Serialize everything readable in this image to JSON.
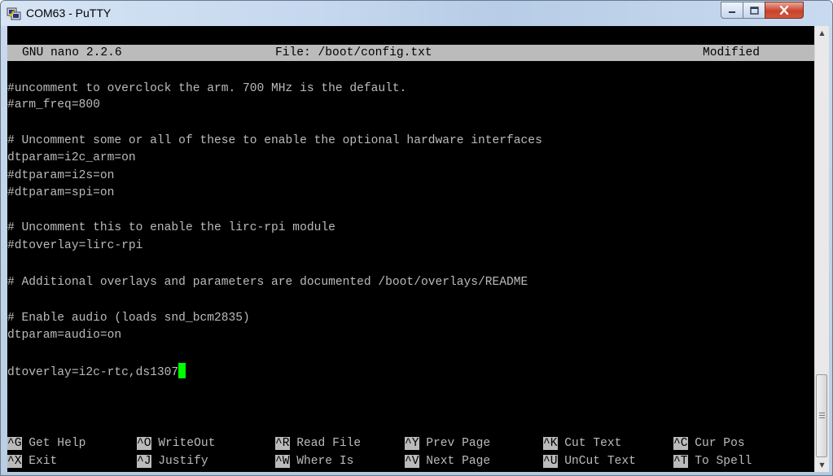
{
  "window": {
    "title": "COM63 - PuTTY",
    "app_icon": "putty-icon",
    "controls": {
      "minimize_icon": "minimize-icon",
      "maximize_icon": "maximize-icon",
      "close_icon": "close-icon"
    }
  },
  "nano": {
    "version": "GNU nano 2.2.6",
    "file": "File: /boot/config.txt",
    "status": "Modified"
  },
  "editor_lines": [
    "#uncomment to overclock the arm. 700 MHz is the default.",
    "#arm_freq=800",
    "",
    "# Uncomment some or all of these to enable the optional hardware interfaces",
    "dtparam=i2c_arm=on",
    "#dtparam=i2s=on",
    "#dtparam=spi=on",
    "",
    "# Uncomment this to enable the lirc-rpi module",
    "#dtoverlay=lirc-rpi",
    "",
    "# Additional overlays and parameters are documented /boot/overlays/README",
    "",
    "# Enable audio (loads snd_bcm2835)",
    "dtparam=audio=on",
    "",
    "dtoverlay=i2c-rtc,ds1307"
  ],
  "shortcuts": {
    "row1": [
      {
        "key": "^G",
        "label": "Get Help"
      },
      {
        "key": "^O",
        "label": "WriteOut"
      },
      {
        "key": "^R",
        "label": "Read File"
      },
      {
        "key": "^Y",
        "label": "Prev Page"
      },
      {
        "key": "^K",
        "label": "Cut Text"
      },
      {
        "key": "^C",
        "label": "Cur Pos"
      }
    ],
    "row2": [
      {
        "key": "^X",
        "label": "Exit"
      },
      {
        "key": "^J",
        "label": "Justify"
      },
      {
        "key": "^W",
        "label": "Where Is"
      },
      {
        "key": "^V",
        "label": "Next Page"
      },
      {
        "key": "^U",
        "label": "UnCut Text"
      },
      {
        "key": "^T",
        "label": "To Spell"
      }
    ]
  },
  "colors": {
    "terminal_bg": "#000000",
    "terminal_fg": "#bbbbbb",
    "cursor": "#00ff00",
    "inverse_bg": "#bbbbbb"
  }
}
